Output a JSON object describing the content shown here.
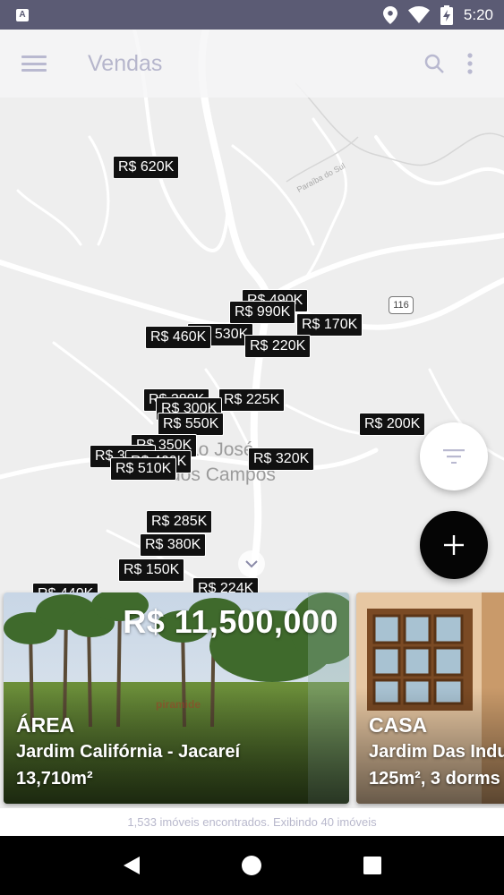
{
  "status_bar": {
    "time": "5:20",
    "notification_icon": "A",
    "icons": [
      "location-icon",
      "wifi-icon",
      "battery-charging-icon"
    ]
  },
  "toolbar": {
    "title": "Vendas",
    "menu_icon": "menu-icon",
    "search_icon": "search-icon",
    "more_icon": "more-vert-icon"
  },
  "map": {
    "city_label_line1": "São José",
    "city_label_line2": "dos Campos",
    "road_label": "Paraíba do Sul",
    "highway_shield": "116",
    "pins": [
      {
        "label": "R$ 620K"
      },
      {
        "label": "R$ 490K"
      },
      {
        "label": "R$ 990K"
      },
      {
        "label": "R$ 170K"
      },
      {
        "label": "R$ 530K"
      },
      {
        "label": "R$ 460K"
      },
      {
        "label": "R$ 220K"
      },
      {
        "label": "R$ 225K"
      },
      {
        "label": "R$ 280K"
      },
      {
        "label": "R$ 300K"
      },
      {
        "label": "R$ 550K"
      },
      {
        "label": "R$ 200K"
      },
      {
        "label": "R$ 350K"
      },
      {
        "label": "R$ 390K"
      },
      {
        "label": "R$ 460K"
      },
      {
        "label": "R$ 510K"
      },
      {
        "label": "R$ 320K"
      },
      {
        "label": "R$ 285K"
      },
      {
        "label": "R$ 380K"
      },
      {
        "label": "R$ 150K"
      },
      {
        "label": "R$ 440K"
      },
      {
        "label": "R$ 224K"
      }
    ]
  },
  "fabs": {
    "filter_icon": "filter-icon",
    "add_icon": "add-icon"
  },
  "cards": [
    {
      "price": "R$ 11,500,000",
      "type": "ÁREA",
      "location": "Jardim Califórnia - Jacareí",
      "details": "13,710m²",
      "watermark": "piramide"
    },
    {
      "price": "",
      "type": "CASA",
      "location": "Jardim Das Indu",
      "details": "125m²,  3 dorms"
    }
  ],
  "footer": {
    "results_text": "1,533 imóveis encontrados. Exibindo 40 imóveis"
  },
  "navbar": {
    "back_icon": "back-icon",
    "home_icon": "home-icon",
    "recents_icon": "recents-icon"
  }
}
